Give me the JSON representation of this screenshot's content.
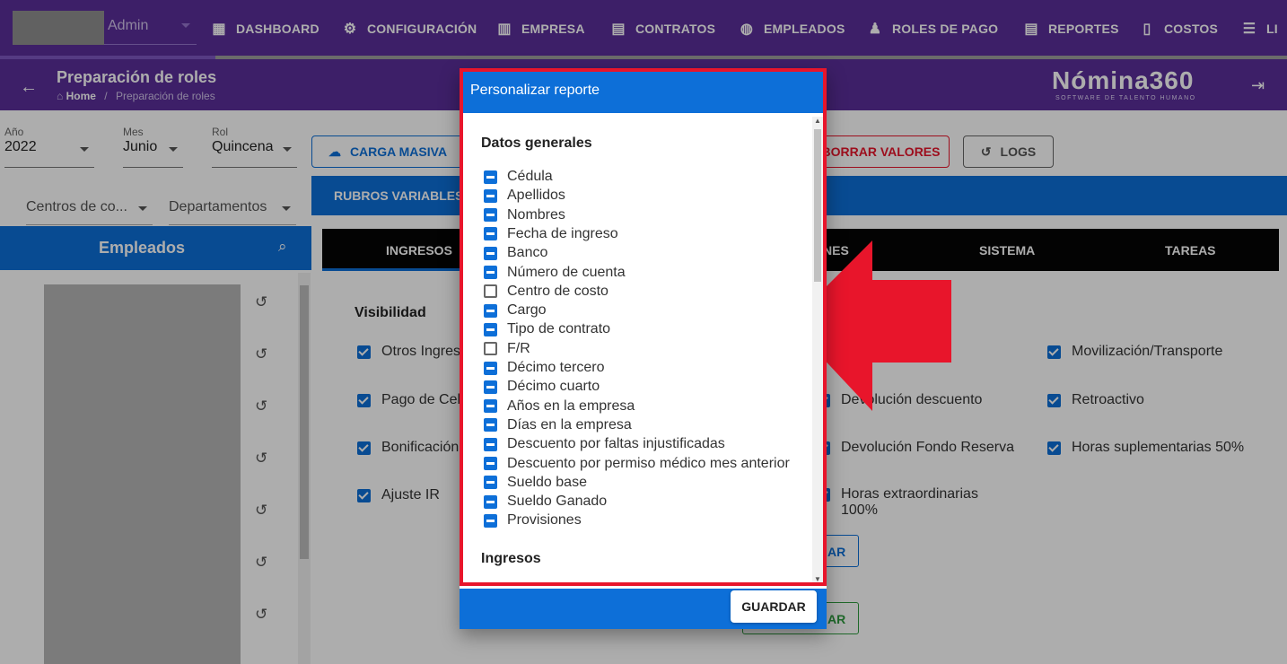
{
  "nav": {
    "company_name": "Admin",
    "items": [
      {
        "label": "DASHBOARD",
        "icon": "dashboard-icon",
        "glyph": "▦"
      },
      {
        "label": "CONFIGURACIÓN",
        "icon": "gear-icon",
        "glyph": "⚙"
      },
      {
        "label": "EMPRESA",
        "icon": "building-icon",
        "glyph": "▥"
      },
      {
        "label": "CONTRATOS",
        "icon": "clipboard-icon",
        "glyph": "▤"
      },
      {
        "label": "EMPLEADOS",
        "icon": "globe-icon",
        "glyph": "◍"
      },
      {
        "label": "ROLES DE PAGO",
        "icon": "users-icon",
        "glyph": "♟"
      },
      {
        "label": "REPORTES",
        "icon": "clipboard-icon",
        "glyph": "▤"
      },
      {
        "label": "COSTOS",
        "icon": "invoice-icon",
        "glyph": "▯"
      },
      {
        "label": "LI",
        "icon": "list-icon",
        "glyph": "☰"
      }
    ]
  },
  "header": {
    "title": "Preparación de roles",
    "breadcrumb_home": "Home",
    "breadcrumb_sep": "/",
    "breadcrumb_current": "Preparación de roles",
    "logo": "Nómina360",
    "tagline": "SOFTWARE DE TALENTO HUMANO"
  },
  "filters": {
    "year_label": "Año",
    "year_value": "2022",
    "month_label": "Mes",
    "month_value": "Junio",
    "role_label": "Rol",
    "role_value": "Quincena",
    "cost_center": "Centros de co...",
    "departments": "Departamentos"
  },
  "actions": {
    "bulk_upload": "CARGA MASIVA",
    "delete_values": "BORRAR VALORES",
    "logs": "LOGS"
  },
  "rubros_title": "RUBROS VARIABLES",
  "employees_title": "Empleados",
  "tabs": [
    "INGRESOS",
    "NES",
    "SISTEMA",
    "TAREAS"
  ],
  "visibility": {
    "title": "Visibilidad",
    "col1": [
      "Otros Ingres",
      "Pago de Cel",
      "Bonificación",
      "Ajuste IR"
    ],
    "col3": [
      "Devolución descuento",
      "Devolución Fondo Reserva",
      "Horas extraordinarias 100%"
    ],
    "col4": [
      "Movilización/Transporte",
      "Retroactivo",
      "Horas suplementarias 50%"
    ],
    "btn1": "AR",
    "btn2": "AR"
  },
  "dialog": {
    "title": "Personalizar reporte",
    "section_general": "Datos generales",
    "options": [
      {
        "label": "Cédula",
        "checked": true
      },
      {
        "label": "Apellidos",
        "checked": true
      },
      {
        "label": "Nombres",
        "checked": true
      },
      {
        "label": "Fecha de ingreso",
        "checked": true
      },
      {
        "label": "Banco",
        "checked": true
      },
      {
        "label": "Número de cuenta",
        "checked": true
      },
      {
        "label": "Centro de costo",
        "checked": false
      },
      {
        "label": "Cargo",
        "checked": true
      },
      {
        "label": "Tipo de contrato",
        "checked": true
      },
      {
        "label": "F/R",
        "checked": false
      },
      {
        "label": "Décimo tercero",
        "checked": true
      },
      {
        "label": "Décimo cuarto",
        "checked": true
      },
      {
        "label": "Años en la empresa",
        "checked": true
      },
      {
        "label": "Días en la empresa",
        "checked": true
      },
      {
        "label": "Descuento por faltas injustificadas",
        "checked": true
      },
      {
        "label": "Descuento por permiso médico mes anterior",
        "checked": true
      },
      {
        "label": "Sueldo base",
        "checked": true
      },
      {
        "label": "Sueldo Ganado",
        "checked": true
      },
      {
        "label": "Provisiones",
        "checked": true
      }
    ],
    "section_income": "Ingresos",
    "save": "GUARDAR"
  },
  "colors": {
    "nav_bg": "#5a2f9a",
    "primary": "#0d6fd8",
    "danger": "#e8152b",
    "highlight_frame": "#e8152b"
  }
}
